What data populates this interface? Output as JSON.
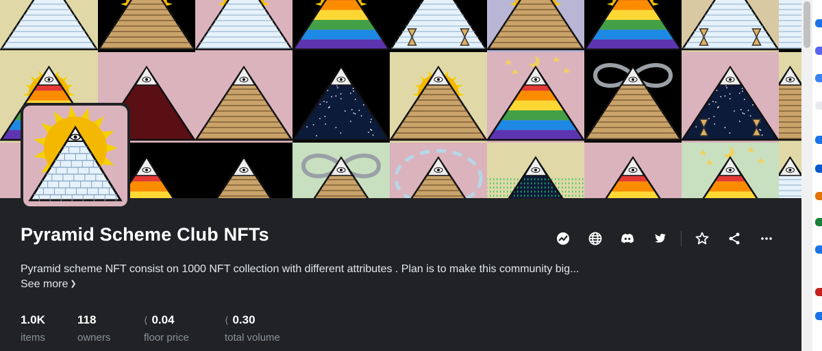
{
  "collection": {
    "name": "Pyramid Scheme Club NFTs",
    "description": "Pyramid scheme NFT consist on 1000 NFT collection with different attributes . Plan is to make this community big...",
    "see_more": "See more"
  },
  "actions": [
    {
      "name": "activity-icon"
    },
    {
      "name": "website-icon"
    },
    {
      "name": "discord-icon"
    },
    {
      "name": "twitter-icon"
    },
    {
      "name": "star-icon"
    },
    {
      "name": "share-icon"
    },
    {
      "name": "more-icon"
    }
  ],
  "stats": [
    {
      "value": "1.0K",
      "label": "items",
      "currency": ""
    },
    {
      "value": "118",
      "label": "owners",
      "currency": ""
    },
    {
      "value": "0.04",
      "label": "floor price",
      "currency": "eth-icon"
    },
    {
      "value": "0.30",
      "label": "total volume",
      "currency": "eth-icon"
    }
  ],
  "colors": {
    "background": "#202225",
    "text_muted": "#8a939b",
    "sand": "#c9a36a",
    "sun": "#f5b800",
    "pink": "#dbb3bd",
    "cream": "#e0d9a7",
    "mint": "#c8e0c0"
  }
}
